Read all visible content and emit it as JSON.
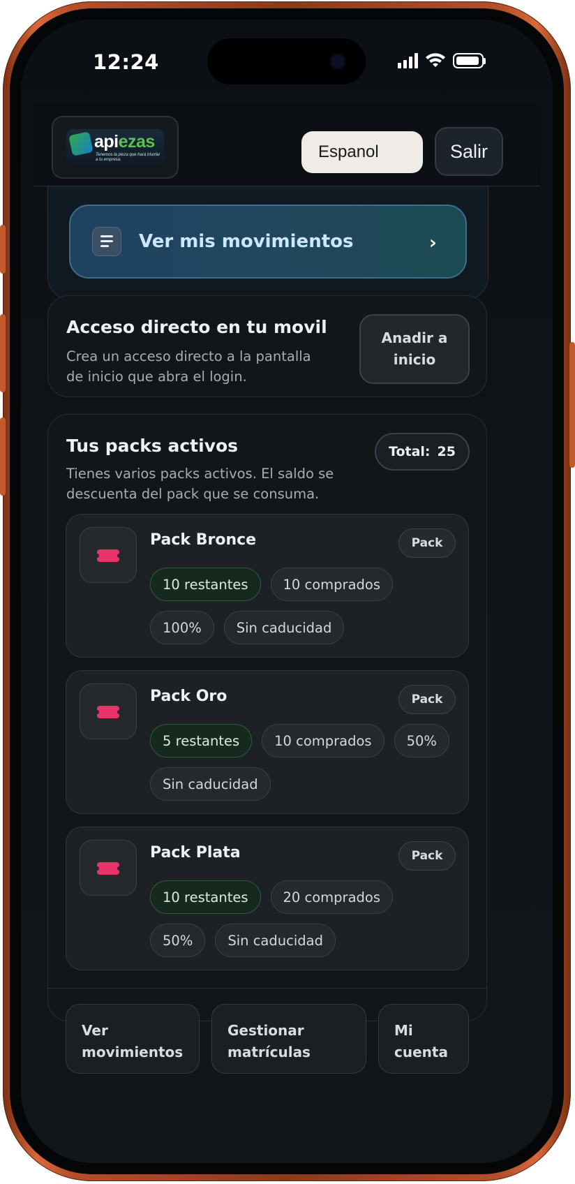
{
  "status_bar": {
    "time": "12:24"
  },
  "header": {
    "logo": {
      "brand_prefix": "api",
      "brand_suffix": "ezas",
      "tagline": "Tenemos la pieza que hará triunfar a tu empresa."
    },
    "language": "Espanol",
    "logout_label": "Salir"
  },
  "movements_button": {
    "label": "Ver mis movimientos",
    "chevron": "›"
  },
  "shortcut": {
    "title": "Acceso directo en tu movil",
    "description": "Crea un acceso directo a la pantalla de inicio que abra el login.",
    "button_label": "Anadir a inicio"
  },
  "packs": {
    "title": "Tus packs activos",
    "description": "Tienes varios packs activos. El saldo se descuenta del pack que se consuma.",
    "total_label": "Total:",
    "total_value": "25",
    "items": [
      {
        "name": "Pack Bronce",
        "type": "Pack",
        "remaining": "10 restantes",
        "purchased": "10 comprados",
        "percent": "100%",
        "expiry": "Sin caducidad"
      },
      {
        "name": "Pack Oro",
        "type": "Pack",
        "remaining": "5 restantes",
        "purchased": "10 comprados",
        "percent": "50%",
        "expiry": "Sin caducidad"
      },
      {
        "name": "Pack Plata",
        "type": "Pack",
        "remaining": "10 restantes",
        "purchased": "20 comprados",
        "percent": "50%",
        "expiry": "Sin caducidad"
      }
    ]
  },
  "bottom_actions": [
    {
      "label": "Ver movimientos"
    },
    {
      "label": "Gestionar matrículas"
    },
    {
      "label": "Mi cuenta"
    }
  ],
  "icons": {
    "menu_list": "list-icon",
    "chevron": "chevron-right-icon",
    "ticket": "ticket-icon",
    "signal": "signal-icon",
    "wifi": "wifi-icon",
    "battery": "battery-icon"
  },
  "colors": {
    "accent_ticket": "#e8336b",
    "remaining_chip": "#15291f",
    "movements_button": "#1f4261"
  }
}
